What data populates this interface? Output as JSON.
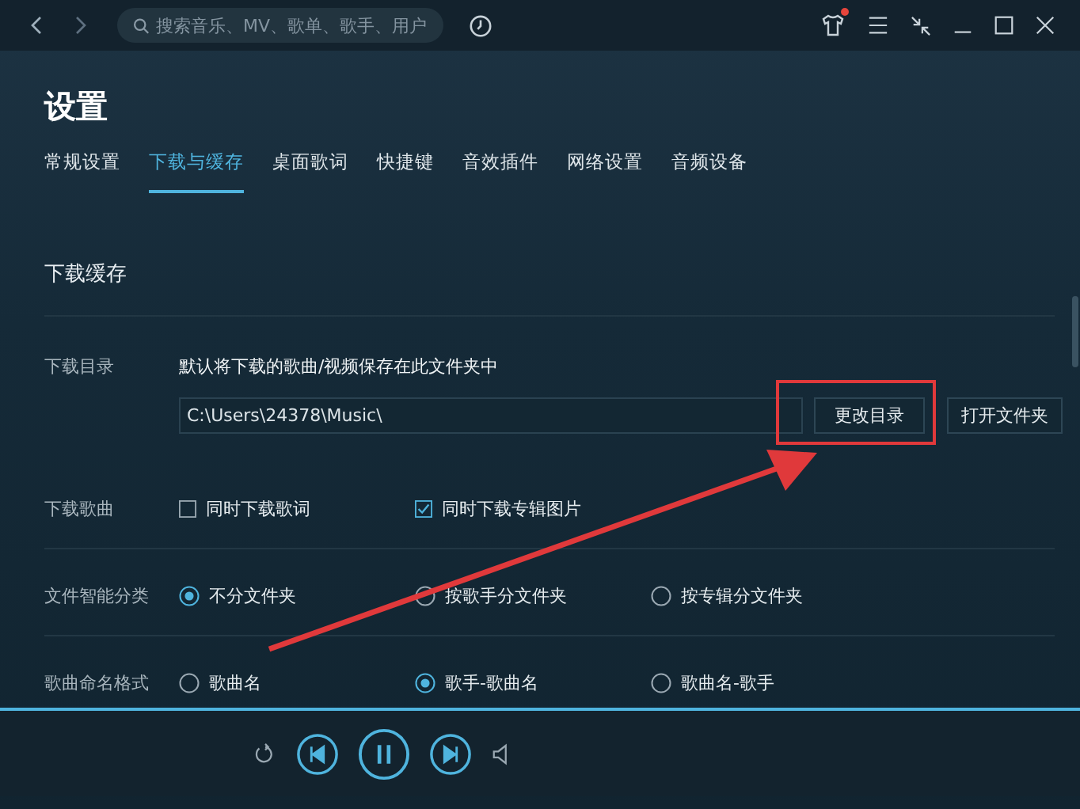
{
  "toolbar": {
    "search": {
      "placeholder": "搜索音乐、MV、歌单、歌手、用户"
    },
    "skin_badge": true
  },
  "page_title": "设置",
  "tabs": [
    {
      "label": "常规设置",
      "selected": false
    },
    {
      "label": "下载与缓存",
      "selected": true
    },
    {
      "label": "桌面歌词",
      "selected": false
    },
    {
      "label": "快捷键",
      "selected": false
    },
    {
      "label": "音效插件",
      "selected": false
    },
    {
      "label": "网络设置",
      "selected": false
    },
    {
      "label": "音频设备",
      "selected": false
    }
  ],
  "section_title": "下载缓存",
  "download_directory": {
    "label": "下载目录",
    "description": "默认将下载的歌曲/视频保存在此文件夹中",
    "path": "C:\\Users\\24378\\Music\\",
    "buttons": [
      "更改目录",
      "打开文件夹"
    ]
  },
  "settings": [
    {
      "label": "下载歌曲",
      "kind": "checkbox",
      "options": [
        {
          "label": "同时下载歌词",
          "checked": false
        },
        {
          "label": "同时下载专辑图片",
          "checked": true
        }
      ]
    },
    {
      "label": "文件智能分类",
      "kind": "radio",
      "options": [
        {
          "label": "不分文件夹",
          "selected": true
        },
        {
          "label": "按歌手分文件夹",
          "selected": false
        },
        {
          "label": "按专辑分文件夹",
          "selected": false
        }
      ]
    },
    {
      "label": "歌曲命名格式",
      "kind": "radio",
      "options": [
        {
          "label": "歌曲名",
          "selected": false
        },
        {
          "label": "歌手-歌曲名",
          "selected": true
        },
        {
          "label": "歌曲名-歌手",
          "selected": false
        }
      ]
    }
  ],
  "player": {
    "playing": true
  }
}
